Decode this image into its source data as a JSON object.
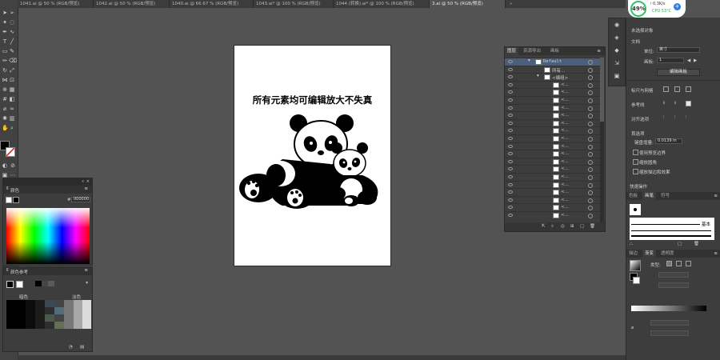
{
  "tabs": [
    "1041.ai @ 50 % (RGB/预览)",
    "1042.ai @ 50 % (RGB/预览)",
    "1040.ai @ 66.67 % (RGB/预览)",
    "1043.ai* @ 100 % (RGB/预览)",
    "1044 (转换).ai* @ 100 % (RGB/预览)",
    "3.ai @ 50 % (RGB/预览)"
  ],
  "perf": {
    "percent": "49%",
    "speed": "0.3K/s",
    "cpu": "CPU 53°C",
    "arrow": "↑"
  },
  "artboard": {
    "title": "所有元素均可编辑放大不失真"
  },
  "layers_panel": {
    "tabs": [
      "图层",
      "资源导出",
      "画板"
    ],
    "top_layer": "Default",
    "row2": "所有...",
    "row3": "<编组>",
    "item_label": "<..."
  },
  "color_panel": {
    "title": "颜色",
    "hex": "000000",
    "hash": "#"
  },
  "color_guide": {
    "title": "颜色参考",
    "dark_label": "暗色",
    "light_label": "淡色"
  },
  "properties": {
    "no_selection": "未选择对象",
    "document": "文档",
    "units_label": "单位:",
    "units_value": "英寸",
    "artboard_label": "画板:",
    "artboard_value": "1",
    "edit_artboard": "编辑画板",
    "rulers_grids": "标尺与网格",
    "guides": "参考线",
    "snap": "对齐选项",
    "preferences": "首选项",
    "keyboard_inc_label": "键盘增量:",
    "keyboard_inc_value": "0.0139 in",
    "use_preview_bounds": "使用预览边界",
    "scale_corners": "缩放圆角",
    "scale_strokes": "缩放描边和效果",
    "quick_actions": "快速操作"
  },
  "brush_panel": {
    "tabs": [
      "色板",
      "画笔",
      "符号"
    ],
    "basic": "基本"
  },
  "gradient_panel": {
    "tabs": [
      "描边",
      "渐变",
      "透明度"
    ],
    "type_label": "类型:"
  }
}
